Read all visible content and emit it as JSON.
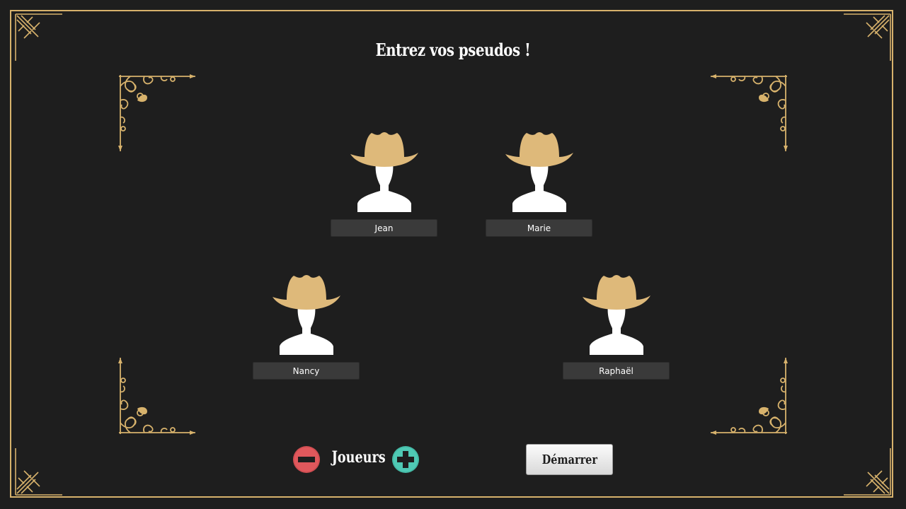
{
  "screen": {
    "title": "Entrez vos pseudos !"
  },
  "players": [
    {
      "name": "Jean",
      "avatar_icon": "cowboy-avatar-icon"
    },
    {
      "name": "Marie",
      "avatar_icon": "cowboy-avatar-icon"
    },
    {
      "name": "Nancy",
      "avatar_icon": "cowboy-avatar-icon"
    },
    {
      "name": "Raphaël",
      "avatar_icon": "cowboy-avatar-icon"
    }
  ],
  "controls": {
    "players_label": "Joueurs",
    "remove_icon": "minus-icon",
    "add_icon": "plus-icon",
    "start_label": "Démarrer"
  },
  "colors": {
    "background": "#1e1e1e",
    "gold": "#d7b26c",
    "hat": "#deb97a",
    "field": "#3a3a3a",
    "remove": "#e0585c",
    "add": "#4fc9b4"
  }
}
